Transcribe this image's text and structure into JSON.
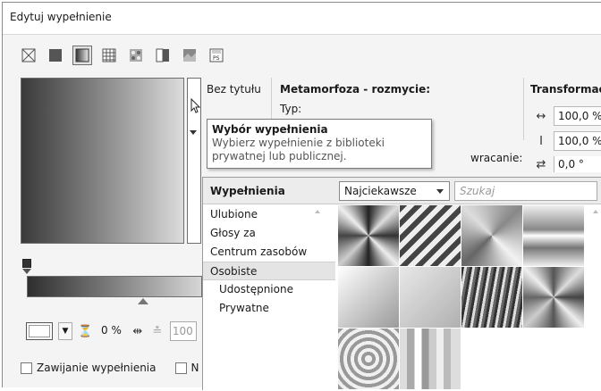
{
  "window": {
    "title": "Edytuj wypełnienie"
  },
  "fill_types": [
    {
      "name": "no-fill-icon"
    },
    {
      "name": "uniform-fill-icon"
    },
    {
      "name": "fountain-fill-icon",
      "active": true
    },
    {
      "name": "vector-pattern-icon"
    },
    {
      "name": "bitmap-pattern-icon"
    },
    {
      "name": "two-color-pattern-icon"
    },
    {
      "name": "texture-fill-icon"
    },
    {
      "name": "postscript-fill-icon"
    }
  ],
  "preview": {
    "name_label": "Bez tytułu"
  },
  "metamorphosis": {
    "title": "Metamorfoza - rozmycie:",
    "type_label": "Typ:",
    "wrap_label": "wracanie:"
  },
  "transform": {
    "title": "Transformac",
    "width_value": "100,0 %",
    "height_value": "100,0 %",
    "third_value": "0,0 °"
  },
  "tooltip": {
    "title": "Wybór wypełnienia",
    "body": "Wybierz wypełnienie z biblioteki prywatnej lub publicznej."
  },
  "picker": {
    "title": "Wypełnienia",
    "sort_value": "Najciekawsze",
    "search_placeholder": "Szukaj",
    "categories": [
      {
        "label": "Ulubione",
        "sub": false,
        "selected": false
      },
      {
        "label": "Głosy za",
        "sub": false,
        "selected": false
      },
      {
        "label": "Centrum zasobów",
        "sub": false,
        "selected": false
      },
      {
        "label": "Osobiste",
        "sub": false,
        "selected": true
      },
      {
        "label": "Udostępnione",
        "sub": true,
        "selected": false
      },
      {
        "label": "Prywatne",
        "sub": true,
        "selected": false
      }
    ],
    "thumbnail_count": 10
  },
  "node_controls": {
    "opacity_value": "0 %",
    "position_value": "100"
  },
  "checkboxes": {
    "wrap_fill_label": "Zawijanie wypełnienia",
    "second_label": "N"
  }
}
